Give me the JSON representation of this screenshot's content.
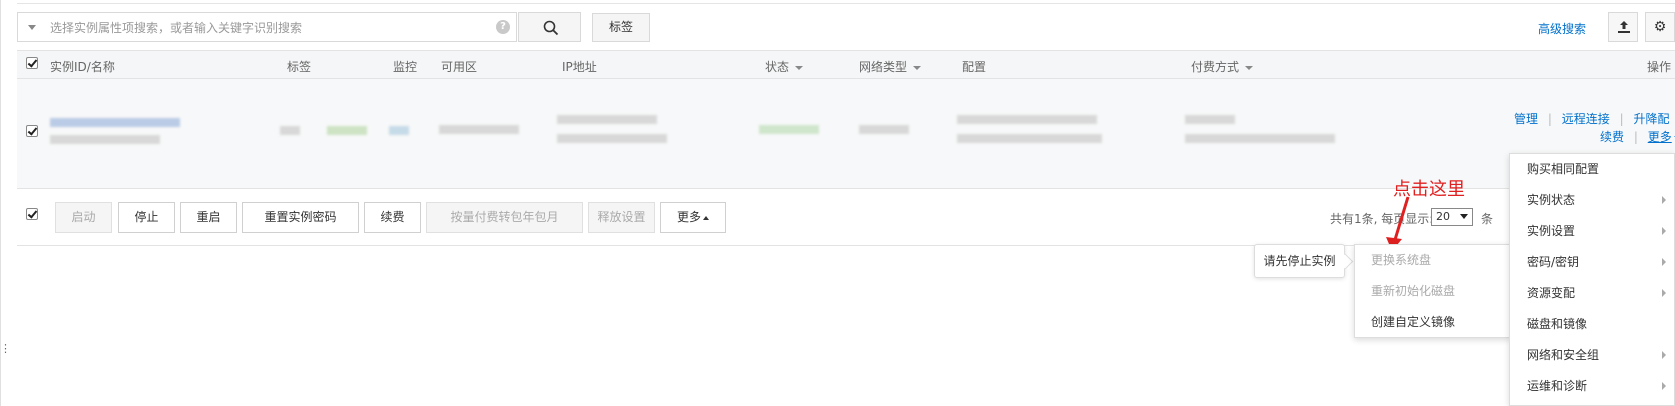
{
  "search": {
    "placeholder": "选择实例属性项搜索，或者输入关键字识别搜索",
    "help": "?",
    "tag_button": "标签",
    "advanced": "高级搜索"
  },
  "table": {
    "headers": {
      "id_name": "实例ID/名称",
      "tags": "标签",
      "monitor": "监控",
      "zone": "可用区",
      "ip": "IP地址",
      "status": "状态",
      "network": "网络类型",
      "config": "配置",
      "billing": "付费方式",
      "actions": "操作"
    },
    "row_actions": {
      "manage": "管理",
      "remote": "远程连接",
      "upgrade": "升降配",
      "renew": "续费",
      "more": "更多",
      "sep": "|"
    }
  },
  "bulk_actions": {
    "start": "启动",
    "stop": "停止",
    "restart": "重启",
    "reset_password": "重置实例密码",
    "renew": "续费",
    "convert": "按量付费转包年包月",
    "release": "释放设置",
    "more": "更多"
  },
  "pager": {
    "text": "共有1条, 每页显示:",
    "size": "20",
    "unit": "条"
  },
  "annotation": "点击这里",
  "more_menu": [
    {
      "label": "购买相同配置",
      "has_sub": false
    },
    {
      "label": "实例状态",
      "has_sub": true
    },
    {
      "label": "实例设置",
      "has_sub": true
    },
    {
      "label": "密码/密钥",
      "has_sub": true
    },
    {
      "label": "资源变配",
      "has_sub": true
    },
    {
      "label": "磁盘和镜像",
      "has_sub": false
    },
    {
      "label": "网络和安全组",
      "has_sub": true
    },
    {
      "label": "运维和诊断",
      "has_sub": true
    }
  ],
  "disk_submenu": [
    {
      "label": "更换系统盘",
      "disabled": true
    },
    {
      "label": "重新初始化磁盘",
      "disabled": true
    },
    {
      "label": "创建自定义镜像",
      "disabled": false
    }
  ],
  "tooltip": "请先停止实例",
  "colors": {
    "link": "#0070cc",
    "annotation": "#e02020"
  }
}
